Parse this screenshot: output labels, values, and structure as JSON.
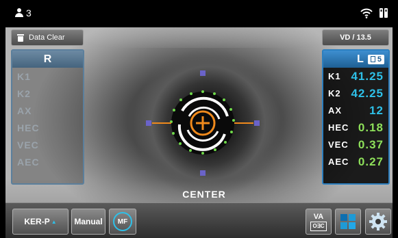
{
  "status_bar": {
    "user_count": "3",
    "icons": [
      "user-icon",
      "wifi-icon",
      "usb-icon"
    ]
  },
  "top_buttons": {
    "data_clear_label": "Data Clear",
    "vd_label": "VD / 13.5"
  },
  "right_eye_panel": {
    "title": "R",
    "rows": [
      {
        "label": "K1",
        "value": ""
      },
      {
        "label": "K2",
        "value": ""
      },
      {
        "label": "AX",
        "value": ""
      },
      {
        "label": "HEC",
        "value": ""
      },
      {
        "label": "VEC",
        "value": ""
      },
      {
        "label": "AEC",
        "value": ""
      }
    ]
  },
  "left_eye_panel": {
    "title": "L",
    "measurement_count": "5",
    "rows": [
      {
        "label": "K1",
        "value": "41.25"
      },
      {
        "label": "K2",
        "value": "42.25"
      },
      {
        "label": "AX",
        "value": "12"
      },
      {
        "label": "HEC",
        "value": "0.18"
      },
      {
        "label": "VEC",
        "value": "0.37"
      },
      {
        "label": "AEC",
        "value": "0.27"
      }
    ]
  },
  "alignment": {
    "label": "CENTER"
  },
  "toolbar": {
    "ker_label": "KER-P",
    "manual_label": "Manual",
    "mf_label": "MF",
    "va_label": "VA",
    "va_sub_label": "O∃C"
  },
  "colors": {
    "accent_blue": "#2c7fbf",
    "value_cyan": "#2ec0e8",
    "value_green": "#8ee05a",
    "target_orange": "#f08a1c",
    "marker_purple": "#6a63c8"
  }
}
